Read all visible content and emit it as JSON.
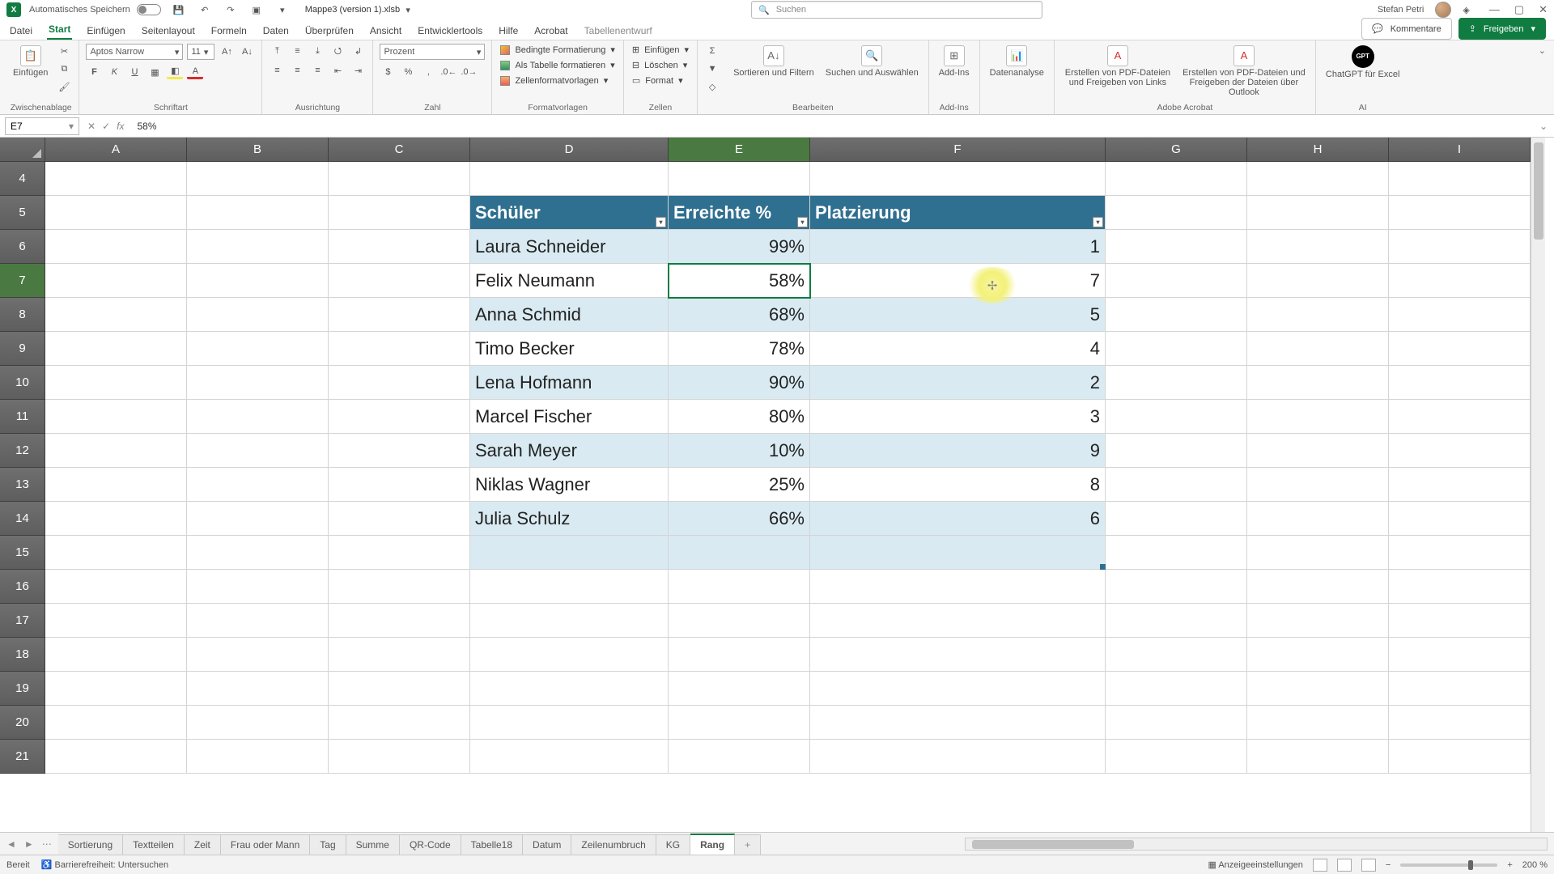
{
  "titlebar": {
    "autosave_label": "Automatisches Speichern",
    "doc_name": "Mappe3 (version 1).xlsb",
    "search_placeholder": "Suchen",
    "user_name": "Stefan Petri"
  },
  "menu": {
    "items": [
      "Datei",
      "Start",
      "Einfügen",
      "Seitenlayout",
      "Formeln",
      "Daten",
      "Überprüfen",
      "Ansicht",
      "Entwicklertools",
      "Hilfe",
      "Acrobat",
      "Tabellenentwurf"
    ],
    "active_index": 1,
    "comments": "Kommentare",
    "share": "Freigeben"
  },
  "ribbon": {
    "clipboard": {
      "paste": "Einfügen",
      "title": "Zwischenablage"
    },
    "font": {
      "name": "Aptos Narrow",
      "size": "11",
      "title": "Schriftart"
    },
    "align": {
      "title": "Ausrichtung"
    },
    "number": {
      "format": "Prozent",
      "title": "Zahl"
    },
    "styles": {
      "cond": "Bedingte Formatierung",
      "astable": "Als Tabelle formatieren",
      "cellfmt": "Zellenformatvorlagen",
      "title": "Formatvorlagen"
    },
    "cells": {
      "insert": "Einfügen",
      "delete": "Löschen",
      "format": "Format",
      "title": "Zellen"
    },
    "editing": {
      "sort": "Sortieren und Filtern",
      "find": "Suchen und Auswählen",
      "title": "Bearbeiten"
    },
    "addins": {
      "btn": "Add-Ins",
      "title": "Add-Ins"
    },
    "data_analysis": "Datenanalyse",
    "acrobat": {
      "a": "Erstellen von PDF-Dateien und Freigeben von Links",
      "b": "Erstellen von PDF-Dateien und Freigeben der Dateien über Outlook",
      "title": "Adobe Acrobat"
    },
    "ai": {
      "btn": "ChatGPT für Excel",
      "title": "AI"
    }
  },
  "formula_bar": {
    "cell_ref": "E7",
    "value": "58%"
  },
  "columns": [
    "A",
    "B",
    "C",
    "D",
    "E",
    "F",
    "G",
    "H",
    "I"
  ],
  "active_col_index": 4,
  "row_start": 4,
  "row_count": 18,
  "active_row": 7,
  "table": {
    "headers": [
      "Schüler",
      "Erreichte %",
      "Platzierung"
    ],
    "rows": [
      {
        "name": "Laura Schneider",
        "pct": "99%",
        "rank": "1"
      },
      {
        "name": "Felix Neumann",
        "pct": "58%",
        "rank": "7"
      },
      {
        "name": "Anna Schmid",
        "pct": "68%",
        "rank": "5"
      },
      {
        "name": "Timo Becker",
        "pct": "78%",
        "rank": "4"
      },
      {
        "name": "Lena Hofmann",
        "pct": "90%",
        "rank": "2"
      },
      {
        "name": "Marcel Fischer",
        "pct": "80%",
        "rank": "3"
      },
      {
        "name": "Sarah Meyer",
        "pct": "10%",
        "rank": "9"
      },
      {
        "name": "Niklas Wagner",
        "pct": "25%",
        "rank": "8"
      },
      {
        "name": "Julia Schulz",
        "pct": "66%",
        "rank": "6"
      }
    ]
  },
  "sheet_tabs": [
    "Sortierung",
    "Textteilen",
    "Zeit",
    "Frau oder Mann",
    "Tag",
    "Summe",
    "QR-Code",
    "Tabelle18",
    "Datum",
    "Zeilenumbruch",
    "KG",
    "Rang"
  ],
  "active_tab_index": 11,
  "statusbar": {
    "mode": "Bereit",
    "access": "Barrierefreiheit: Untersuchen",
    "display": "Anzeigeeinstellungen",
    "zoom": "200 %"
  }
}
